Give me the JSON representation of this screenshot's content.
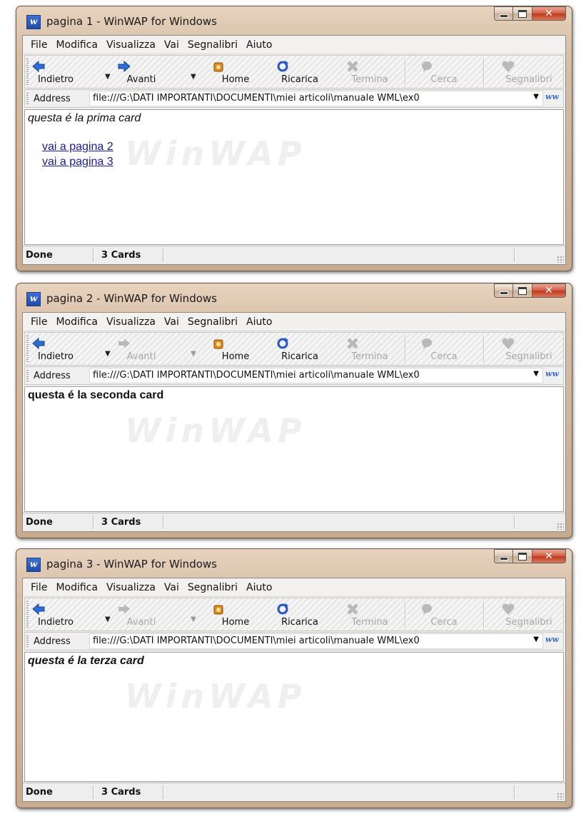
{
  "menu": [
    "File",
    "Modifica",
    "Visualizza",
    "Vai",
    "Segnalibri",
    "Aiuto"
  ],
  "address_label": "Address",
  "toolbar_colors": {
    "back": "#2b6fd6",
    "forward": "#2b6fd6",
    "home": "#e08a1e",
    "reload": "#2557c9",
    "disabled": "#b9b9b9"
  },
  "windows": [
    {
      "title": "pagina 1 - WinWAP for Windows",
      "toolbar": [
        "Indietro",
        "Avanti",
        "Home",
        "Ricarica",
        "Termina",
        "Cerca",
        "Segnalibri"
      ],
      "forward_enabled": true,
      "address": "file:///G:\\DATI IMPORTANTI\\DOCUMENTI\\miei articoli\\manuale WML\\ex0",
      "content_text": "questa é la prima card",
      "links": [
        "vai a pagina 2",
        "vai a pagina 3"
      ],
      "status": "Done",
      "cards": "3 Cards"
    },
    {
      "title": "pagina 2 - WinWAP for Windows",
      "toolbar": [
        "Indietro",
        "Avanti",
        "Home",
        "Ricarica",
        "Termina",
        "Cerca",
        "Segnalibri"
      ],
      "forward_enabled": false,
      "address": "file:///G:\\DATI IMPORTANTI\\DOCUMENTI\\miei articoli\\manuale WML\\ex0",
      "content_text": "questa é la seconda card",
      "links": [],
      "status": "Done",
      "cards": "3 Cards"
    },
    {
      "title": "pagina 3 - WinWAP for Windows",
      "toolbar": [
        "Indietro",
        "Avanti",
        "Home",
        "Ricarica",
        "Termina",
        "Cerca",
        "Segnalibri"
      ],
      "forward_enabled": false,
      "address": "file:///G:\\DATI IMPORTANTI\\DOCUMENTI\\miei articoli\\manuale WML\\ex0",
      "content_text": "questa é la terza card",
      "links": [],
      "status": "Done",
      "cards": "3 Cards"
    }
  ]
}
